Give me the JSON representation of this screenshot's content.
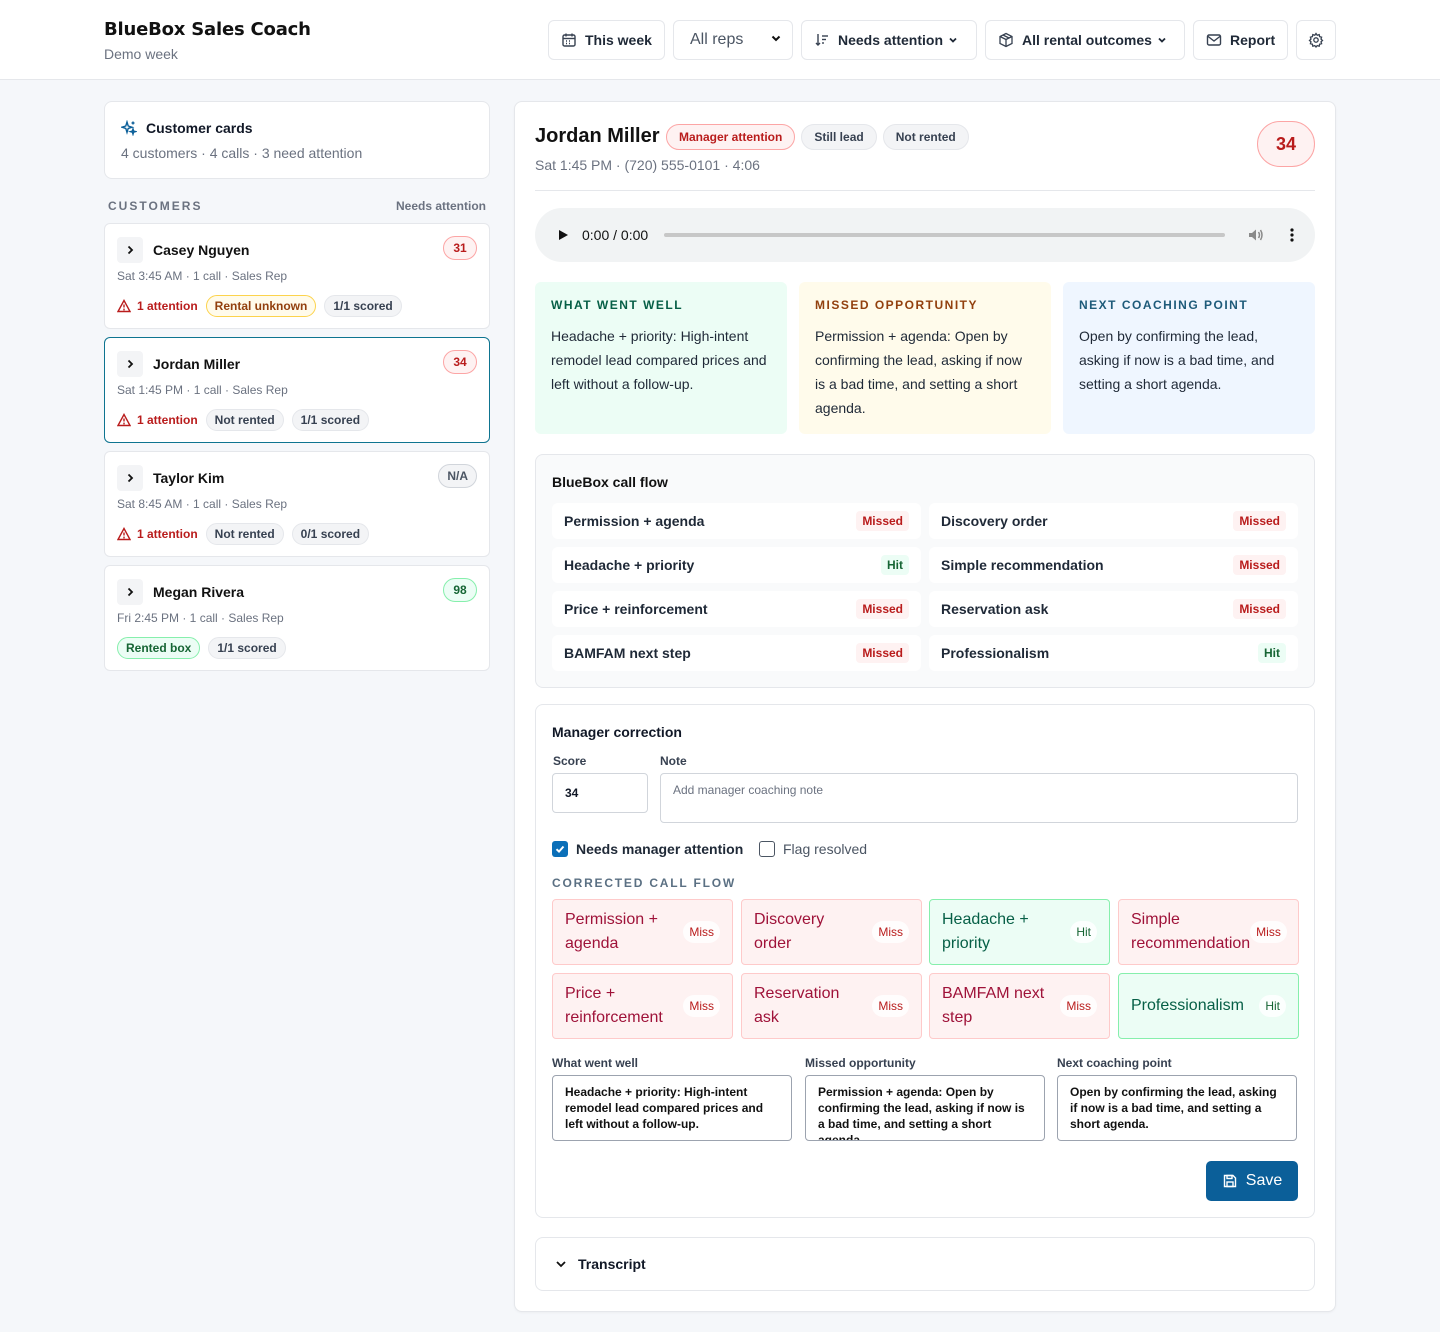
{
  "app": {
    "title": "BlueBox Sales Coach",
    "subtitle": "Demo week"
  },
  "header": {
    "week_label": "This week",
    "reps_select": "All reps",
    "sort_label": "Needs attention",
    "outcomes_label": "All rental outcomes",
    "report_label": "Report"
  },
  "summary": {
    "title": "Customer cards",
    "subtitle": "4 customers · 4 calls · 3 need attention"
  },
  "customers_header": {
    "label": "CUSTOMERS",
    "sort": "Needs attention"
  },
  "customers": [
    {
      "name": "Casey Nguyen",
      "meta": "Sat 3:45 AM · 1 call · Sales Rep",
      "score": "31",
      "attention": "1 attention",
      "outcome": "Rental unknown",
      "scored": "1/1 scored"
    },
    {
      "name": "Jordan Miller",
      "meta": "Sat 1:45 PM · 1 call · Sales Rep",
      "score": "34",
      "attention": "1 attention",
      "outcome": "Not rented",
      "scored": "1/1 scored"
    },
    {
      "name": "Taylor Kim",
      "meta": "Sat 8:45 AM · 1 call · Sales Rep",
      "score": "N/A",
      "attention": "1 attention",
      "outcome": "Not rented",
      "scored": "0/1 scored"
    },
    {
      "name": "Megan Rivera",
      "meta": "Fri 2:45 PM · 1 call · Sales Rep",
      "score": "98",
      "outcome": "Rented box",
      "scored": "1/1 scored"
    }
  ],
  "detail": {
    "name": "Jordan Miller",
    "badges": [
      "Manager attention",
      "Still lead",
      "Not rented"
    ],
    "meta": "Sat 1:45 PM · (720) 555-0101 · 4:06",
    "score": "34",
    "audio": {
      "time": "0:00 / 0:00",
      "progress": 0
    },
    "insights": {
      "well": {
        "title": "WHAT WENT WELL",
        "body": "Headache + priority: High-intent remodel lead compared prices and left without a follow-up."
      },
      "missed": {
        "title": "MISSED OPPORTUNITY",
        "body": "Permission + agenda: Open by confirming the lead, asking if now is a bad time, and setting a short agenda."
      },
      "next": {
        "title": "NEXT COACHING POINT",
        "body": "Open by confirming the lead, asking if now is a bad time, and setting a short agenda."
      }
    },
    "call_flow": {
      "title": "BlueBox call flow",
      "items": [
        {
          "label": "Permission + agenda",
          "status": "Missed"
        },
        {
          "label": "Discovery order",
          "status": "Missed"
        },
        {
          "label": "Headache + priority",
          "status": "Hit"
        },
        {
          "label": "Simple recommendation",
          "status": "Missed"
        },
        {
          "label": "Price + reinforcement",
          "status": "Missed"
        },
        {
          "label": "Reservation ask",
          "status": "Missed"
        },
        {
          "label": "BAMFAM next step",
          "status": "Missed"
        },
        {
          "label": "Professionalism",
          "status": "Hit"
        }
      ]
    },
    "correction": {
      "title": "Manager correction",
      "score_label": "Score",
      "score_value": "34",
      "note_label": "Note",
      "note_placeholder": "Add manager coaching note",
      "needs_attention_label": "Needs manager attention",
      "needs_attention_checked": true,
      "flag_resolved_label": "Flag resolved",
      "flag_resolved_checked": false,
      "corrected_title": "CORRECTED CALL FLOW",
      "corrected": [
        {
          "label": "Permission + agenda",
          "status": "Miss"
        },
        {
          "label": "Discovery order",
          "status": "Miss"
        },
        {
          "label": "Headache + priority",
          "status": "Hit"
        },
        {
          "label": "Simple recommendation",
          "status": "Miss"
        },
        {
          "label": "Price + reinforcement",
          "status": "Miss"
        },
        {
          "label": "Reservation ask",
          "status": "Miss"
        },
        {
          "label": "BAMFAM next step",
          "status": "Miss"
        },
        {
          "label": "Professionalism",
          "status": "Hit"
        }
      ],
      "well_label": "What went well",
      "well_value": "Headache + priority: High-intent remodel lead compared prices and left without a follow-up.",
      "missed_label": "Missed opportunity",
      "missed_value": "Permission + agenda: Open by confirming the lead, asking if now is a bad time, and setting a short agenda.",
      "next_label": "Next coaching point",
      "next_value": "Open by confirming the lead, asking if now is a bad time, and setting a short agenda.",
      "save_label": "Save"
    },
    "transcript_label": "Transcript"
  },
  "colors": {
    "accent": "#0b5f99",
    "selected_border": "#0e7490",
    "miss": "#b91c1c",
    "hit": "#166534"
  }
}
